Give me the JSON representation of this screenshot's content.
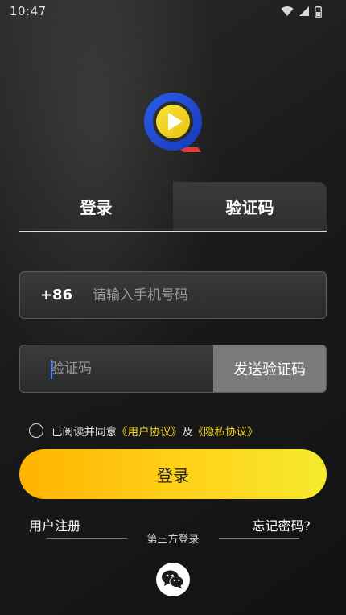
{
  "status_bar": {
    "time": "10:47",
    "icons": [
      "wifi-icon",
      "signal-icon",
      "battery-icon"
    ]
  },
  "logo": {
    "icon": "play-logo-icon"
  },
  "tabs": [
    {
      "label": "登录",
      "active": true
    },
    {
      "label": "验证码",
      "active": false
    }
  ],
  "phone": {
    "country_code": "+86",
    "placeholder": "请输入手机号码",
    "value": ""
  },
  "code": {
    "placeholder": "验证码",
    "value": "",
    "send_label": "发送验证码"
  },
  "agreement": {
    "checked": false,
    "prefix": "已阅读并同意",
    "user_agreement": "《用户协议》",
    "conjunction": "及",
    "privacy_policy": "《隐私协议》"
  },
  "login_button_label": "登录",
  "footer": {
    "register_label": "用户注册",
    "forgot_label": "忘记密码?",
    "third_party_label": "第三方登录",
    "wechat_icon": "wechat-icon"
  },
  "colors": {
    "accent": "#ffd21a",
    "link": "#f2d21c",
    "logo_blue": "#1e4fd8",
    "logo_yellow": "#f2d21c",
    "logo_red": "#e53935"
  }
}
